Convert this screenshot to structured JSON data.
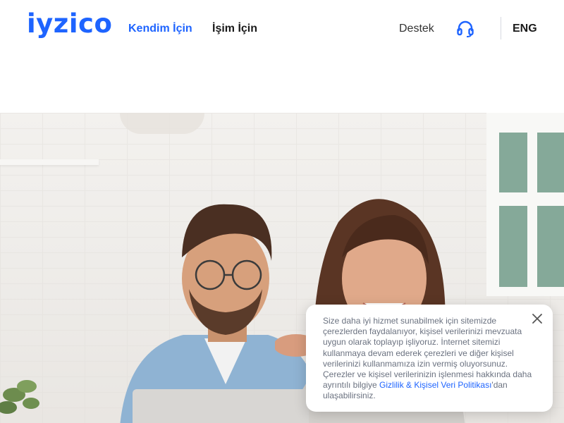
{
  "header": {
    "logo": "iyzico",
    "nav": {
      "personal": "Kendim İçin",
      "business": "İşim İçin"
    },
    "support_label": "Destek",
    "support_icon": "headset-icon",
    "language": "ENG"
  },
  "colors": {
    "brand": "#1e64ff",
    "text_dark": "#1a1a1a",
    "muted": "#6b7280"
  },
  "cookie_banner": {
    "text": "Size daha iyi hizmet sunabilmek için sitemizde çerezlerden faydalanıyor, kişisel verilerinizi mevzuata uygun olarak toplayıp işliyoruz. İnternet sitemizi kullanmaya devam ederek çerezleri ve diğer kişisel verilerinizi kullanmamıza izin vermiş oluyorsunuz. Çerezler ve kişisel verilerinizin işlenmesi hakkında daha ayrıntılı bilgiye ",
    "link_text": "Gizlilik & Kişisel Veri Politikası",
    "suffix": "'dan ulaşabilirsiniz.",
    "close_icon": "close-icon"
  }
}
